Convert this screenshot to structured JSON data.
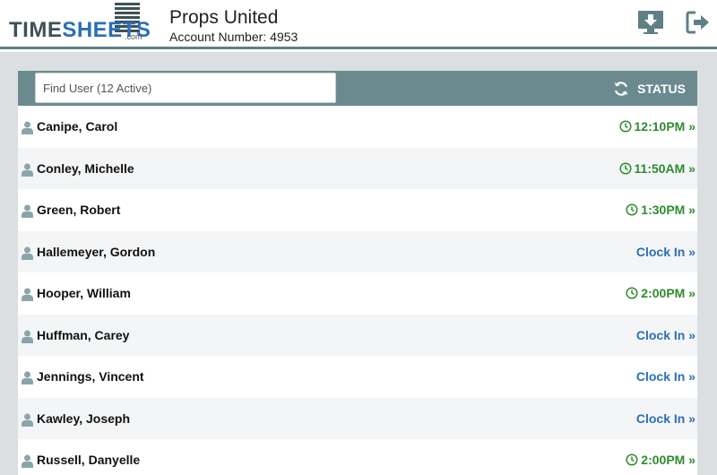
{
  "header": {
    "logo": {
      "part1": "TIME",
      "part2": "SHEETS",
      "suffix": ".com"
    },
    "company_name": "Props United",
    "account_label": "Account Number:",
    "account_number": "4953",
    "download_icon": "monitor-download-icon",
    "logout_icon": "logout-icon"
  },
  "toolbar": {
    "search_placeholder": "Find User (12 Active)",
    "status_label": "STATUS",
    "status_icon": "refresh-icon"
  },
  "users": [
    {
      "name": "Canipe, Carol",
      "action": "12:10PM »",
      "type": "time"
    },
    {
      "name": "Conley, Michelle",
      "action": "11:50AM »",
      "type": "time"
    },
    {
      "name": "Green, Robert",
      "action": "1:30PM »",
      "type": "time"
    },
    {
      "name": "Hallemeyer, Gordon",
      "action": "Clock In »",
      "type": "clockin"
    },
    {
      "name": "Hooper, William",
      "action": "2:00PM »",
      "type": "time"
    },
    {
      "name": "Huffman, Carey",
      "action": "Clock In »",
      "type": "clockin"
    },
    {
      "name": "Jennings, Vincent",
      "action": "Clock In »",
      "type": "clockin"
    },
    {
      "name": "Kawley, Joseph",
      "action": "Clock In »",
      "type": "clockin"
    },
    {
      "name": "Russell, Danyelle",
      "action": "2:00PM »",
      "type": "time"
    }
  ],
  "colors": {
    "accent": "#6a8a90",
    "time_green": "#2e8b2e",
    "link_blue": "#2a6fb8",
    "page_bg": "#dcdfe1"
  }
}
